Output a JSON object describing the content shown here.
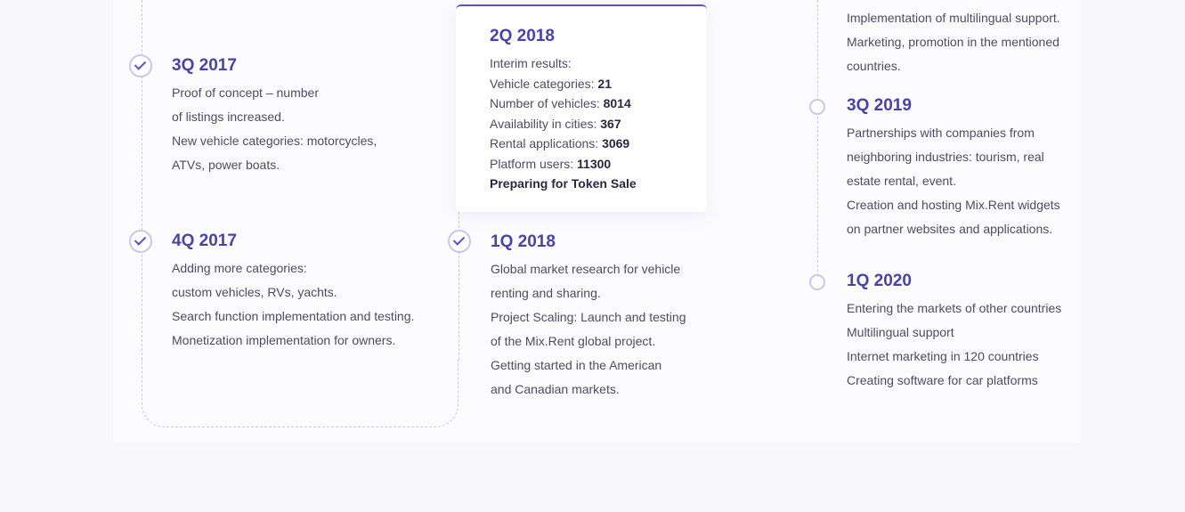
{
  "milestones": {
    "q3_2017": {
      "title": "3Q 2017",
      "lines": [
        "Proof of concept – number",
        "of listings increased.",
        "New vehicle categories: motorcycles,",
        "ATVs, power boats."
      ]
    },
    "q4_2017": {
      "title": "4Q 2017",
      "lines": [
        "Adding more categories:",
        "custom vehicles, RVs, yachts.",
        "Search function implementation and testing.",
        "Monetization implementation for owners."
      ]
    },
    "q2_2018": {
      "title": "2Q 2018",
      "intro": "Interim results:",
      "stats": [
        {
          "label": "Vehicle categories:",
          "value": "21"
        },
        {
          "label": "Number of vehicles:",
          "value": "8014"
        },
        {
          "label": "Availability in cities:",
          "value": "367"
        },
        {
          "label": "Rental applications:",
          "value": "3069"
        },
        {
          "label": "Platform users:",
          "value": "11300"
        }
      ],
      "highlight": "Preparing for Token Sale"
    },
    "q1_2018": {
      "title": "1Q 2018",
      "lines": [
        "Global market research for vehicle",
        "renting and sharing.",
        "Project Scaling: Launch and testing",
        "of the Mix.Rent global project.",
        "Getting started in the American",
        "and Canadian markets."
      ]
    },
    "previous_tail": {
      "lines": [
        "Implementation of multilingual support.",
        "Marketing, promotion in the mentioned",
        "countries."
      ]
    },
    "q3_2019": {
      "title": "3Q 2019",
      "lines": [
        "Partnerships with companies from",
        "neighboring industries: tourism, real",
        "estate rental, event.",
        "Creation and hosting Mix.Rent widgets",
        "on partner websites and applications."
      ]
    },
    "q1_2020": {
      "title": "1Q 2020",
      "lines": [
        "Entering the markets of other countries",
        "Multilingual support",
        "Internet marketing in 120 countries",
        "Creating software for car platforms"
      ]
    }
  }
}
